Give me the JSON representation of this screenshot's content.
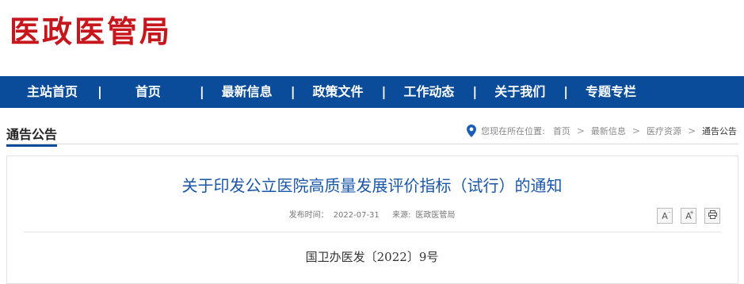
{
  "header": {
    "logo_text": "医政医管局"
  },
  "nav": {
    "items": [
      {
        "label": "主站首页"
      },
      {
        "label": "首页"
      },
      {
        "label": "最新信息"
      },
      {
        "label": "政策文件"
      },
      {
        "label": "工作动态"
      },
      {
        "label": "关于我们"
      },
      {
        "label": "专题专栏"
      }
    ],
    "separator": "|"
  },
  "section": {
    "title": "通告公告"
  },
  "breadcrumb": {
    "prefix": "您现在所在位置:",
    "items": [
      "首页",
      "最新信息",
      "医疗资源"
    ],
    "current": "通告公告",
    "arrow": ">"
  },
  "article": {
    "title": "关于印发公立医院高质量发展评价指标（试行）的通知",
    "publish_label": "发布时间：",
    "publish_date": "2022-07-31",
    "source_label": "来源:",
    "source": "医政医管局",
    "doc_number": "国卫办医发〔2022〕9号"
  },
  "tools": {
    "font_decrease": "A",
    "font_decrease_sup": "-",
    "font_increase": "A",
    "font_increase_sup": "+",
    "print_icon": "print-icon"
  },
  "colors": {
    "brand_red": "#c8161d",
    "nav_blue": "#0a4c9a",
    "title_blue": "#1a56a8"
  }
}
